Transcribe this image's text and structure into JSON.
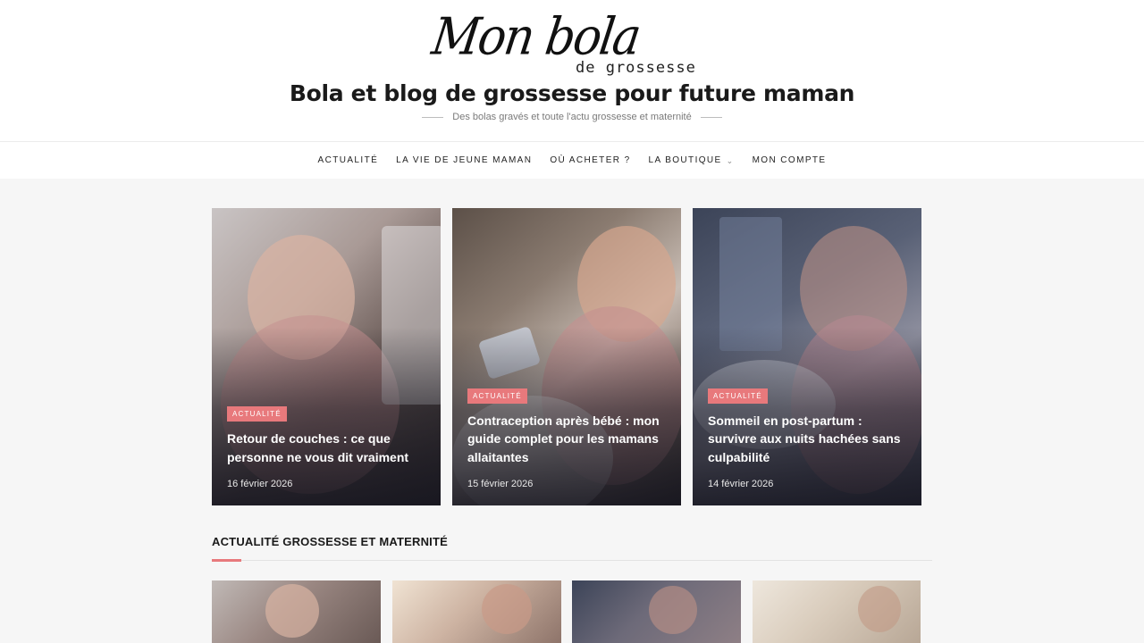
{
  "header": {
    "logo_script": "Mon bola",
    "logo_sub": "de grossesse",
    "site_title": "Bola et blog de grossesse pour future maman",
    "tagline": "Des bolas gravés et toute l'actu grossesse et maternité"
  },
  "nav": {
    "items": [
      {
        "label": "ACTUALITÉ"
      },
      {
        "label": "LA VIE DE JEUNE MAMAN"
      },
      {
        "label": "OÙ ACHETER ?"
      },
      {
        "label": "LA BOUTIQUE",
        "chevron": "chevron-down-icon"
      },
      {
        "label": "MON COMPTE"
      }
    ]
  },
  "featured": [
    {
      "category": "ACTUALITÉ",
      "title": "Retour de couches : ce que personne ne vous dit vraiment",
      "date": "16 février 2026"
    },
    {
      "category": "ACTUALITÉ",
      "title": "Contraception après bébé : mon guide complet pour les mamans allaitantes",
      "date": "15 février 2026"
    },
    {
      "category": "ACTUALITÉ",
      "title": "Sommeil en post-partum : survivre aux nuits hachées sans culpabilité",
      "date": "14 février 2026"
    }
  ],
  "section": {
    "title": "ACTUALITÉ GROSSESSE ET MATERNITÉ"
  },
  "colors": {
    "accent": "#e8797c",
    "background": "#f6f6f6",
    "header_bg": "#ffffff"
  }
}
